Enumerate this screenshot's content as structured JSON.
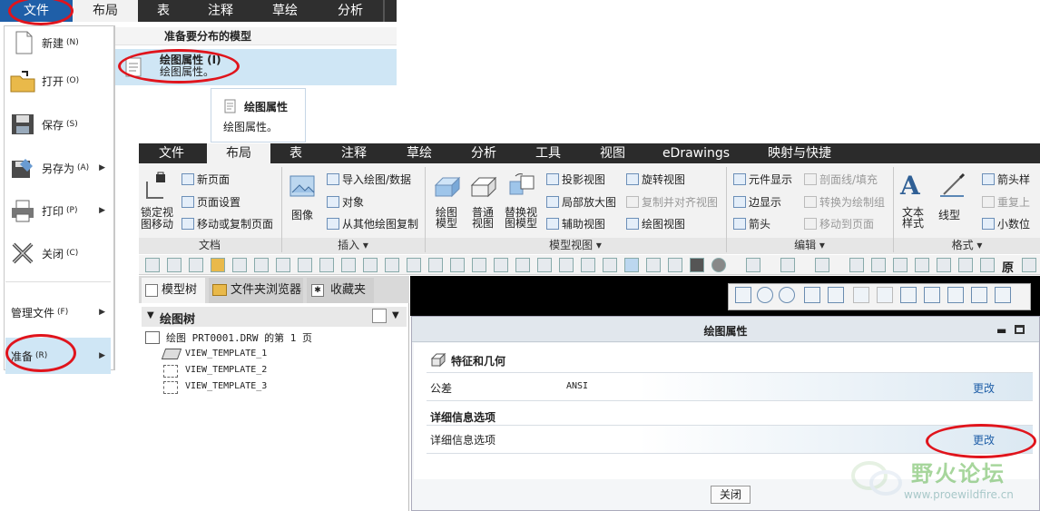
{
  "top_tabs": [
    "文件",
    "布局",
    "表",
    "注释",
    "草绘",
    "分析"
  ],
  "file_menu": {
    "items": [
      {
        "label": "新建",
        "key": "(N)"
      },
      {
        "label": "打开",
        "key": "(O)"
      },
      {
        "label": "保存",
        "key": "(S)"
      },
      {
        "label": "另存为",
        "key": "(A)"
      },
      {
        "label": "打印",
        "key": "(P)"
      },
      {
        "label": "关闭",
        "key": "(C)"
      },
      {
        "label": "管理文件",
        "key": "(F)"
      },
      {
        "label": "准备",
        "key": "(R)"
      }
    ],
    "submenu_header": "准备要分布的模型",
    "submenu_item_title": "绘图属性 (I)",
    "submenu_item_desc": "绘图属性。"
  },
  "tooltip": {
    "title": "绘图属性",
    "desc": "绘图属性。"
  },
  "ribbon": {
    "tabs": [
      "文件",
      "布局",
      "表",
      "注释",
      "草绘",
      "分析",
      "工具",
      "视图",
      "eDrawings",
      "映射与快捷"
    ],
    "doc": {
      "lock_label": "锁定视\n图移动",
      "new_page": "新页面",
      "page_setup": "页面设置",
      "move_copy": "移动或复制页面",
      "group": "文档"
    },
    "insert": {
      "image": "图像",
      "import": "导入绘图/数据",
      "object": "对象",
      "copy_from": "从其他绘图复制",
      "group": "插入"
    },
    "model_views": {
      "drawing_model": "绘图\n模型",
      "general": "普通\n视图",
      "replace": "替换视\n图模型",
      "projection": "投影视图",
      "detail": "局部放大图",
      "auxiliary": "辅助视图",
      "revolved": "旋转视图",
      "copy_align": "复制并对齐视图",
      "drawing_view": "绘图视图",
      "group": "模型视图"
    },
    "edit": {
      "element_display": "元件显示",
      "border_display": "边显示",
      "arrow": "箭头",
      "section_fill": "剖面线/填充",
      "convert_group": "转换为绘制组",
      "move_to_page": "移动到页面",
      "group": "编辑"
    },
    "format": {
      "text_style": "文本\n样式",
      "line_style": "线型",
      "arrow_style": "箭头样",
      "repeat": "重复上",
      "decimals": "小数位",
      "group": "格式"
    }
  },
  "tree_tabs": [
    "模型树",
    "文件夹浏览器",
    "收藏夹"
  ],
  "tree": {
    "header": "绘图树",
    "root": "绘图 PRT0001.DRW 的第 1 页",
    "children": [
      "VIEW_TEMPLATE_1",
      "VIEW_TEMPLATE_2",
      "VIEW_TEMPLATE_3"
    ]
  },
  "toolbar_text": "原",
  "dialog": {
    "title": "绘图属性",
    "section1": "特征和几何",
    "tolerance_label": "公差",
    "tolerance_value": "ANSI",
    "change1": "更改",
    "section2": "详细信息选项",
    "detail_label": "详细信息选项",
    "change2": "更改",
    "close": "关闭"
  },
  "watermark": {
    "cn": "野火论坛",
    "url": "www.proewildfire.cn"
  },
  "colors": {
    "tab_active": "#1f3f7a",
    "ribbon_bar": "#2b2b2b",
    "highlight": "#cfe6f5",
    "annotation": "#e0141c"
  }
}
